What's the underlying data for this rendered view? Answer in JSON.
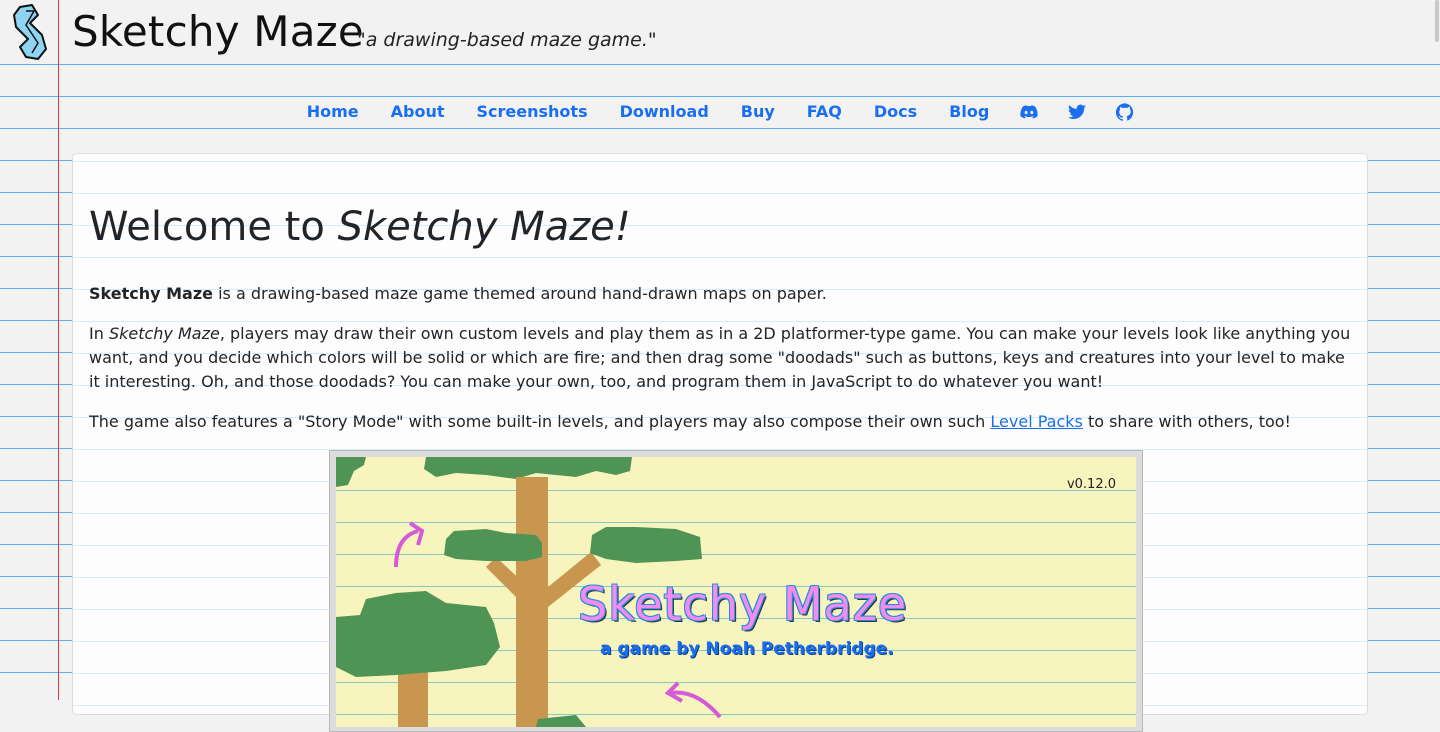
{
  "site": {
    "title": "Sketchy Maze",
    "tagline": "\"a drawing-based maze game.\"",
    "logo_icon": "sketchy-maze-logo"
  },
  "nav": {
    "links": [
      {
        "label": "Home"
      },
      {
        "label": "About"
      },
      {
        "label": "Screenshots"
      },
      {
        "label": "Download"
      },
      {
        "label": "Buy"
      },
      {
        "label": "FAQ"
      },
      {
        "label": "Docs"
      },
      {
        "label": "Blog"
      }
    ],
    "icons": [
      {
        "name": "discord-icon"
      },
      {
        "name": "twitter-icon"
      },
      {
        "name": "github-icon"
      }
    ]
  },
  "main": {
    "heading_prefix": "Welcome to ",
    "heading_emphasis": "Sketchy Maze!",
    "p1": {
      "bold": "Sketchy Maze",
      "rest": " is a drawing-based maze game themed around hand-drawn maps on paper."
    },
    "p2": {
      "prefix": "In ",
      "emphasis": "Sketchy Maze",
      "rest": ", players may draw their own custom levels and play them as in a 2D platformer-type game. You can make your levels look like anything you want, and you decide which colors will be solid or which are fire; and then drag some \"doodads\" such as buttons, keys and creatures into your level to make it interesting. Oh, and those doodads? You can make your own, too, and program them in JavaScript to do whatever you want!"
    },
    "p3": {
      "prefix": "The game also features a \"Story Mode\" with some built-in levels, and players may also compose their own such ",
      "link": "Level Packs",
      "suffix": " to share with others, too!"
    },
    "screenshot": {
      "version": "v0.12.0",
      "title": "Sketchy Maze",
      "subtitle": "a game by Noah Petherbridge."
    }
  },
  "colors": {
    "link": "#1a6ef0",
    "margin_line": "#e0383e",
    "rule_line": "#5aaef0",
    "game_paper": "#f8f4bd",
    "tree_leaves": "#4f9455",
    "tree_trunk": "#c8964e",
    "arrow": "#d65ad6"
  }
}
